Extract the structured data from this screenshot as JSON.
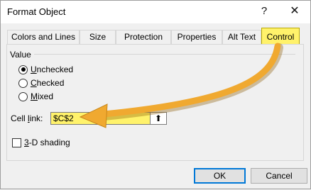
{
  "window": {
    "title": "Format Object",
    "help_glyph": "?",
    "close_glyph": "✕"
  },
  "tabs": [
    {
      "label": "Colors and Lines",
      "active": false
    },
    {
      "label": "Size",
      "active": false
    },
    {
      "label": "Protection",
      "active": false
    },
    {
      "label": "Properties",
      "active": false
    },
    {
      "label": "Alt Text",
      "active": false
    },
    {
      "label": "Control",
      "active": true
    }
  ],
  "value_group": {
    "label": "Value",
    "options": [
      {
        "first": "U",
        "rest": "nchecked",
        "checked": true
      },
      {
        "first": "C",
        "rest": "hecked",
        "checked": false
      },
      {
        "first": "M",
        "rest": "ixed",
        "checked": false
      }
    ]
  },
  "cell_link": {
    "label_pre": "Cell ",
    "label_u": "l",
    "label_post": "ink:",
    "value": "$C$2",
    "button_icon": "collapse-dialog-icon",
    "button_glyph": "⬆"
  },
  "shading": {
    "first": "3",
    "rest": "-D shading",
    "checked": false
  },
  "buttons": {
    "ok": "OK",
    "cancel": "Cancel"
  },
  "colors": {
    "highlight": "#fff26b",
    "arrow": "#f0a930",
    "focus": "#0078d7"
  }
}
